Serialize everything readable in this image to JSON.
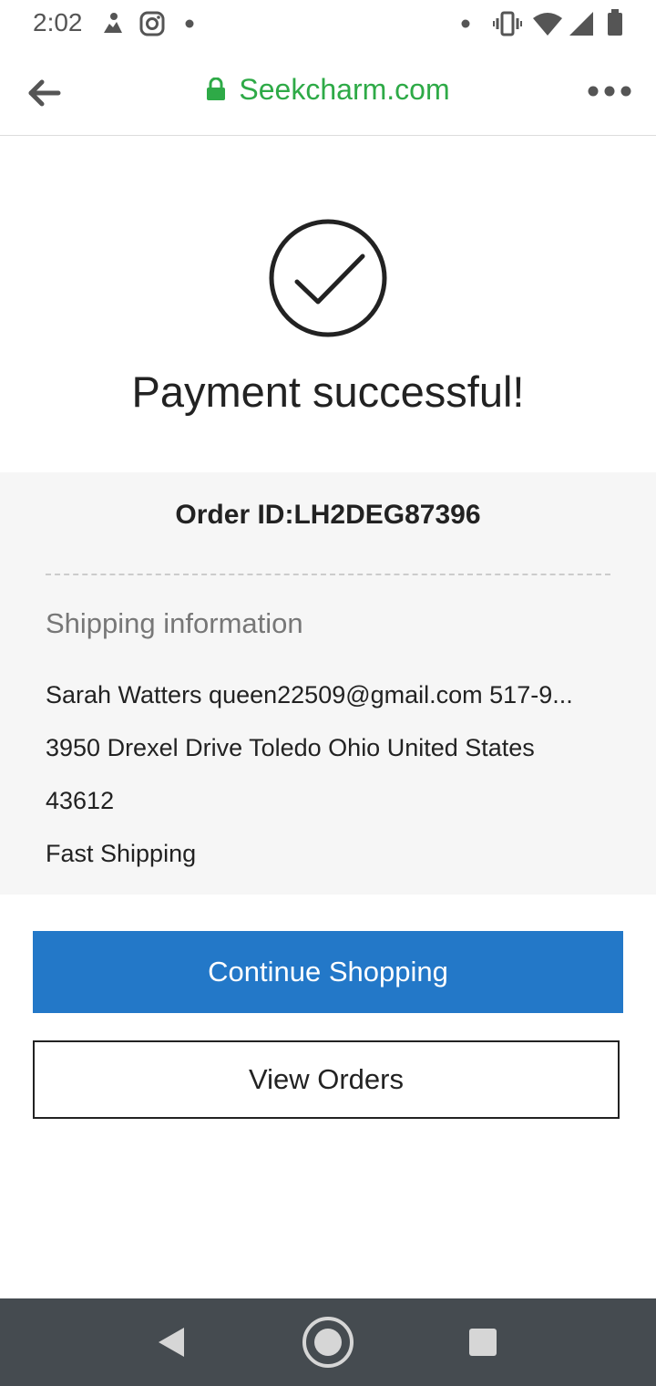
{
  "status_bar": {
    "time": "2:02",
    "left_icons": [
      "notification-icon",
      "instagram-icon",
      "dot-icon"
    ],
    "right_icons": [
      "dot-icon",
      "vibrate-icon",
      "wifi-icon",
      "signal-icon",
      "battery-icon"
    ]
  },
  "browser": {
    "url": "Seekcharm.com",
    "url_color": "#2eaa47"
  },
  "success": {
    "title": "Payment successful!"
  },
  "order": {
    "order_id_text": "Order ID:LH2DEG87396"
  },
  "shipping": {
    "heading": "Shipping information",
    "line1": "Sarah  Watters  queen22509@gmail.com  517-9...",
    "line2": "3950 Drexel Drive  Toledo  Ohio  United States",
    "line3": "43612",
    "line4": "Fast Shipping"
  },
  "buttons": {
    "continue_label": "Continue Shopping",
    "view_orders_label": "View Orders",
    "primary_color": "#2378c8"
  }
}
